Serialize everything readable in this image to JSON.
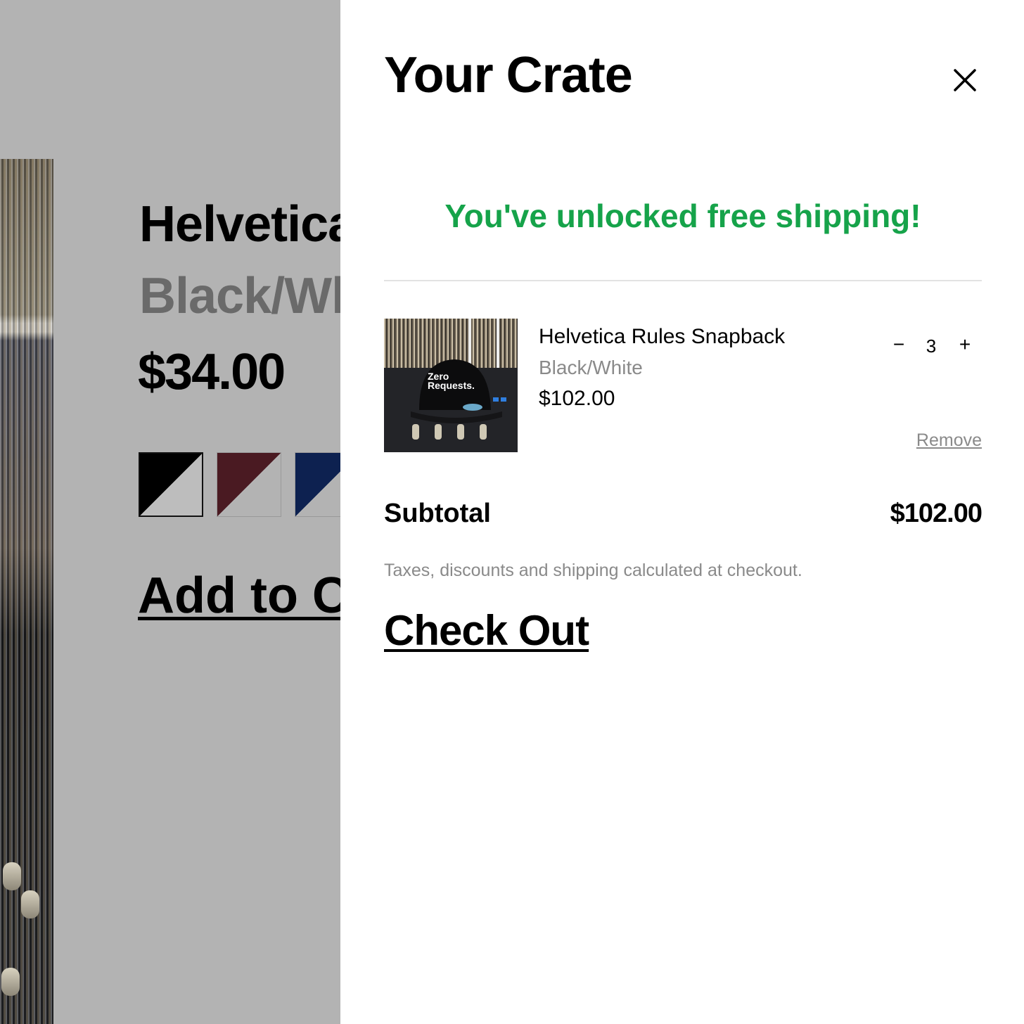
{
  "background_page": {
    "product_title": "Helvetica Rules Snapback",
    "variant": "Black/White",
    "price": "$34.00",
    "add_to_cart_label": "Add to Cart",
    "swatches": [
      "black",
      "maroon",
      "navy"
    ]
  },
  "cart": {
    "title": "Your Crate",
    "close_icon": "close-icon",
    "free_shipping_message": "You've unlocked free shipping!",
    "items": [
      {
        "name": "Helvetica Rules Snapback",
        "variant": "Black/White",
        "price": "$102.00",
        "quantity": "3",
        "minus_label": "−",
        "plus_label": "+",
        "remove_label": "Remove",
        "thumbnail_text": [
          "Zero",
          "Requests."
        ]
      }
    ],
    "subtotal_label": "Subtotal",
    "subtotal_value": "$102.00",
    "tax_note": "Taxes, discounts and shipping calculated at checkout.",
    "checkout_label": "Check Out"
  },
  "colors": {
    "promo_green": "#16a34a",
    "overlay_gray": "#b3b3b3",
    "muted_text": "#8a8a8a"
  }
}
